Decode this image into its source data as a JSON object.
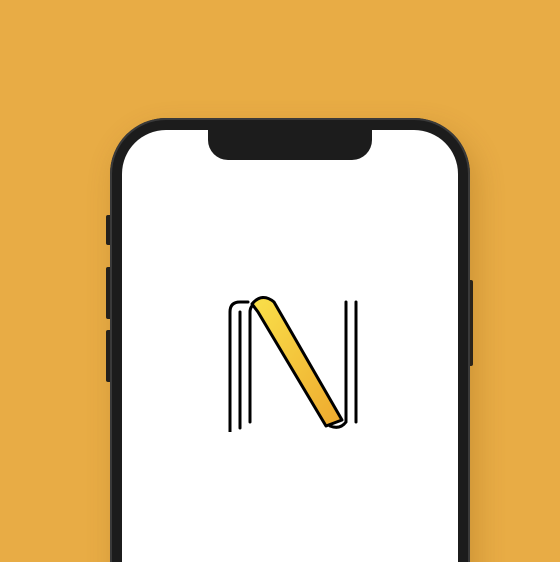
{
  "background": {
    "color": "#E8AC45"
  },
  "device": {
    "frame_color": "#1c1c1c",
    "screen_color": "#FFFFFF"
  },
  "app": {
    "logo": {
      "name": "N-logo-icon",
      "accent_colors": [
        "#F9E04A",
        "#EEA92E"
      ],
      "stroke_color": "#000000"
    }
  }
}
